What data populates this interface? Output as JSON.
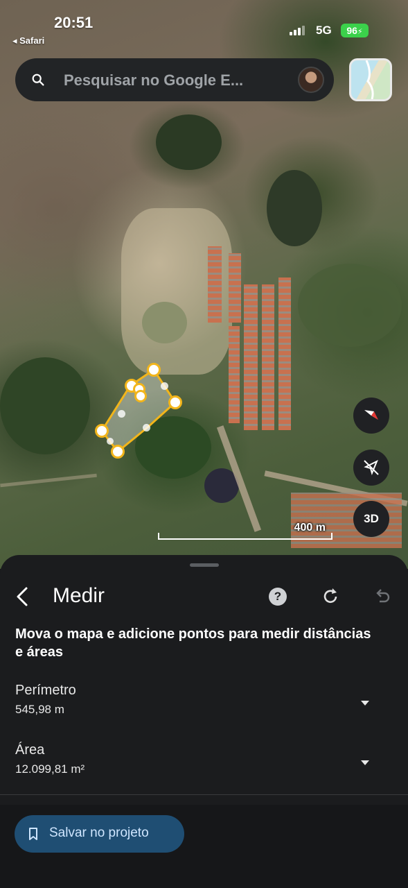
{
  "status_bar": {
    "time": "20:51",
    "back_app": "◂ Safari",
    "network": "5G",
    "battery": "96"
  },
  "search": {
    "placeholder": "Pesquisar no Google E..."
  },
  "map": {
    "scale_label": "400 m",
    "control_3d": "3D"
  },
  "panel": {
    "title": "Medir",
    "help_glyph": "?",
    "instruction": "Mova o mapa e adicione pontos para medir distâncias e áreas",
    "perimeter": {
      "label": "Perímetro",
      "value": "545,98 m"
    },
    "area": {
      "label": "Área",
      "value": "12.099,81 m²"
    },
    "save_label": "Salvar no projeto"
  },
  "colors": {
    "measure_line": "#f2b51b",
    "panel_bg": "#1b1c1e",
    "save_button": "#1f4e73"
  }
}
